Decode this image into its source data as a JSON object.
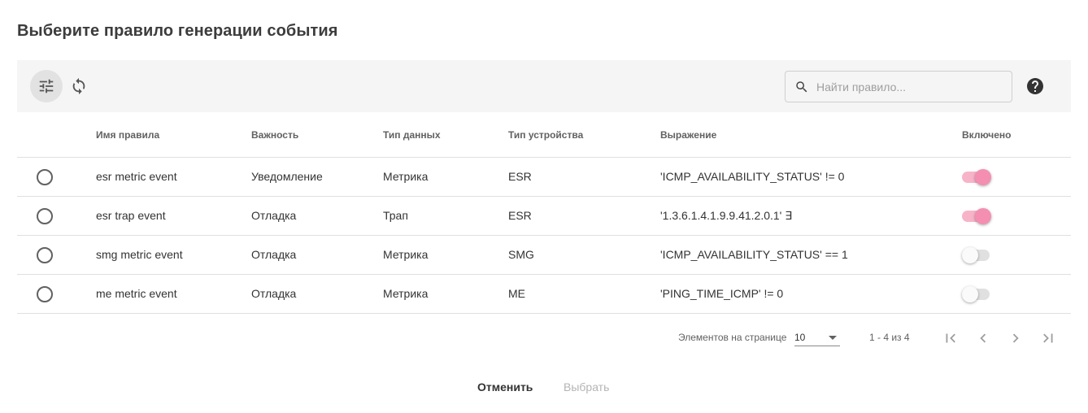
{
  "dialog": {
    "title": "Выберите правило генерации события"
  },
  "toolbar": {
    "filter_icon": "tune-icon",
    "refresh_icon": "sync-icon",
    "search_placeholder": "Найти правило...",
    "search_value": "",
    "help_icon": "help-circle-icon"
  },
  "table": {
    "headers": {
      "name": "Имя правила",
      "severity": "Важность",
      "data_type": "Тип данных",
      "device_type": "Тип устройства",
      "expression": "Выражение",
      "enabled": "Включено"
    },
    "rows": [
      {
        "name": "esr metric event",
        "severity": "Уведомление",
        "data_type": "Метрика",
        "device_type": "ESR",
        "expression": "'ICMP_AVAILABILITY_STATUS' != 0",
        "enabled": true,
        "selected": false
      },
      {
        "name": "esr trap event",
        "severity": "Отладка",
        "data_type": "Трап",
        "device_type": "ESR",
        "expression": "'1.3.6.1.4.1.9.9.41.2.0.1' ∃",
        "enabled": true,
        "selected": false
      },
      {
        "name": "smg metric event",
        "severity": "Отладка",
        "data_type": "Метрика",
        "device_type": "SMG",
        "expression": "'ICMP_AVAILABILITY_STATUS' == 1",
        "enabled": false,
        "selected": false
      },
      {
        "name": "me metric event",
        "severity": "Отладка",
        "data_type": "Метрика",
        "device_type": "ME",
        "expression": "'PING_TIME_ICMP' != 0",
        "enabled": false,
        "selected": false
      }
    ]
  },
  "paginator": {
    "page_size_label": "Элементов на странице",
    "page_size": "10",
    "range_label": "1 - 4 из 4"
  },
  "actions": {
    "cancel_label": "Отменить",
    "select_label": "Выбрать"
  },
  "colors": {
    "toggle_on_track": "#f7b4c8",
    "toggle_on_thumb": "#f48fb1",
    "toolbar_bg": "#f5f5f5"
  }
}
